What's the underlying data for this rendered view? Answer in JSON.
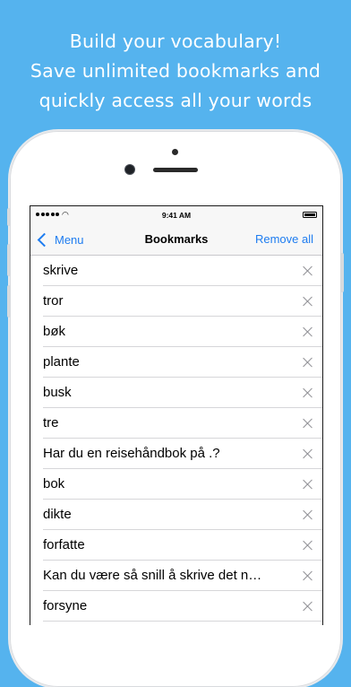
{
  "promo": {
    "lines": [
      "Build your vocabulary!",
      "Save unlimited bookmarks and",
      "quickly access all your words"
    ]
  },
  "status_bar": {
    "time": "9:41 AM"
  },
  "nav": {
    "back_label": "Menu",
    "title": "Bookmarks",
    "action_label": "Remove all"
  },
  "bookmarks": [
    "skrive",
    "tror",
    "bøk",
    "plante",
    "busk",
    "tre",
    "Har du en reisehåndbok på .?",
    "bok",
    "dikte",
    "forfatte",
    "Kan du være så snill å skrive det n…",
    "forsyne"
  ],
  "colors": {
    "background": "#55b3ee",
    "accent": "#1e7cf0"
  }
}
